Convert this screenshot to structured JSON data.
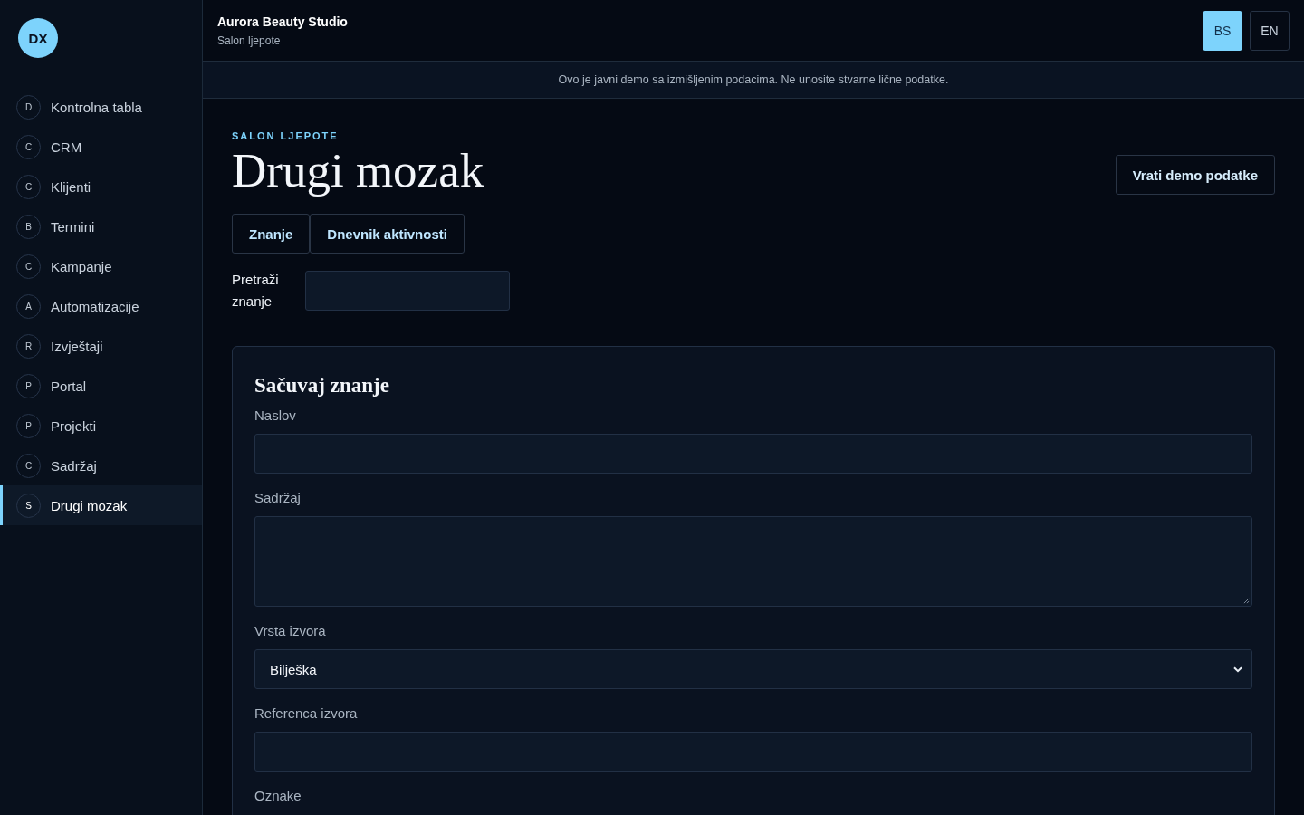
{
  "sidebar": {
    "avatar": "DX",
    "items": [
      {
        "badge": "D",
        "label": "Kontrolna tabla",
        "selected": false
      },
      {
        "badge": "C",
        "label": "CRM",
        "selected": false
      },
      {
        "badge": "C",
        "label": "Klijenti",
        "selected": false
      },
      {
        "badge": "B",
        "label": "Termini",
        "selected": false
      },
      {
        "badge": "C",
        "label": "Kampanje",
        "selected": false
      },
      {
        "badge": "A",
        "label": "Automatizacije",
        "selected": false
      },
      {
        "badge": "R",
        "label": "Izvještaji",
        "selected": false
      },
      {
        "badge": "P",
        "label": "Portal",
        "selected": false
      },
      {
        "badge": "P",
        "label": "Projekti",
        "selected": false
      },
      {
        "badge": "C",
        "label": "Sadržaj",
        "selected": false
      },
      {
        "badge": "S",
        "label": "Drugi mozak",
        "selected": true
      }
    ]
  },
  "header": {
    "title": "Aurora Beauty Studio",
    "subtitle": "Salon ljepote",
    "languages": [
      {
        "label": "BS",
        "selected": true
      },
      {
        "label": "EN",
        "selected": false
      }
    ]
  },
  "banner": "Ovo je javni demo sa izmišljenim podacima. Ne unosite stvarne lične podatke.",
  "page": {
    "eyebrow": "SALON LJEPOTE",
    "title": "Drugi mozak",
    "reset_button": "Vrati demo podatke",
    "tabs": [
      {
        "label": "Znanje",
        "selected": false
      },
      {
        "label": "Dnevnik aktivnosti",
        "selected": false
      }
    ],
    "search": {
      "label": "Pretraži znanje"
    }
  },
  "form": {
    "title": "Sačuvaj znanje",
    "fields": [
      {
        "kind": "text",
        "label": "Naslov"
      },
      {
        "kind": "textarea",
        "label": "Sadržaj"
      },
      {
        "kind": "select",
        "label": "Vrsta izvora",
        "value": "Bilješka"
      },
      {
        "kind": "text",
        "label": "Referenca izvora"
      },
      {
        "kind": "label",
        "label": "Oznake"
      }
    ]
  }
}
